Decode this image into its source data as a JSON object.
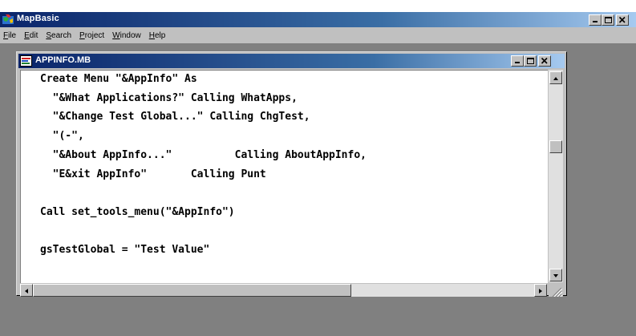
{
  "app": {
    "title": "MapBasic",
    "menu": [
      {
        "label": "File",
        "key": "F",
        "rest": "ile"
      },
      {
        "label": "Edit",
        "key": "E",
        "rest": "dit"
      },
      {
        "label": "Search",
        "key": "S",
        "rest": "earch"
      },
      {
        "label": "Project",
        "key": "P",
        "rest": "roject"
      },
      {
        "label": "Window",
        "key": "W",
        "rest": "indow"
      },
      {
        "label": "Help",
        "key": "H",
        "rest": "elp"
      }
    ]
  },
  "child": {
    "title": "APPINFO.MB",
    "code_lines": [
      "Create Menu \"&AppInfo\" As",
      "  \"&What Applications?\" Calling WhatApps,",
      "  \"&Change Test Global...\" Calling ChgTest,",
      "  \"(-\",",
      "  \"&About AppInfo...\"          Calling AboutAppInfo,",
      "  \"E&xit AppInfo\"       Calling Punt",
      "",
      "Call set_tools_menu(\"&AppInfo\")",
      "",
      "gsTestGlobal = \"Test Value\""
    ]
  },
  "icons": {
    "app": "mapbasic-globe-icon",
    "document": "mapbasic-document-icon"
  },
  "colors": {
    "titlebar_active": "#0a246a",
    "titlebar_fade": "#a6caf0",
    "face": "#c0c0c0",
    "mdi_background": "#808080"
  }
}
